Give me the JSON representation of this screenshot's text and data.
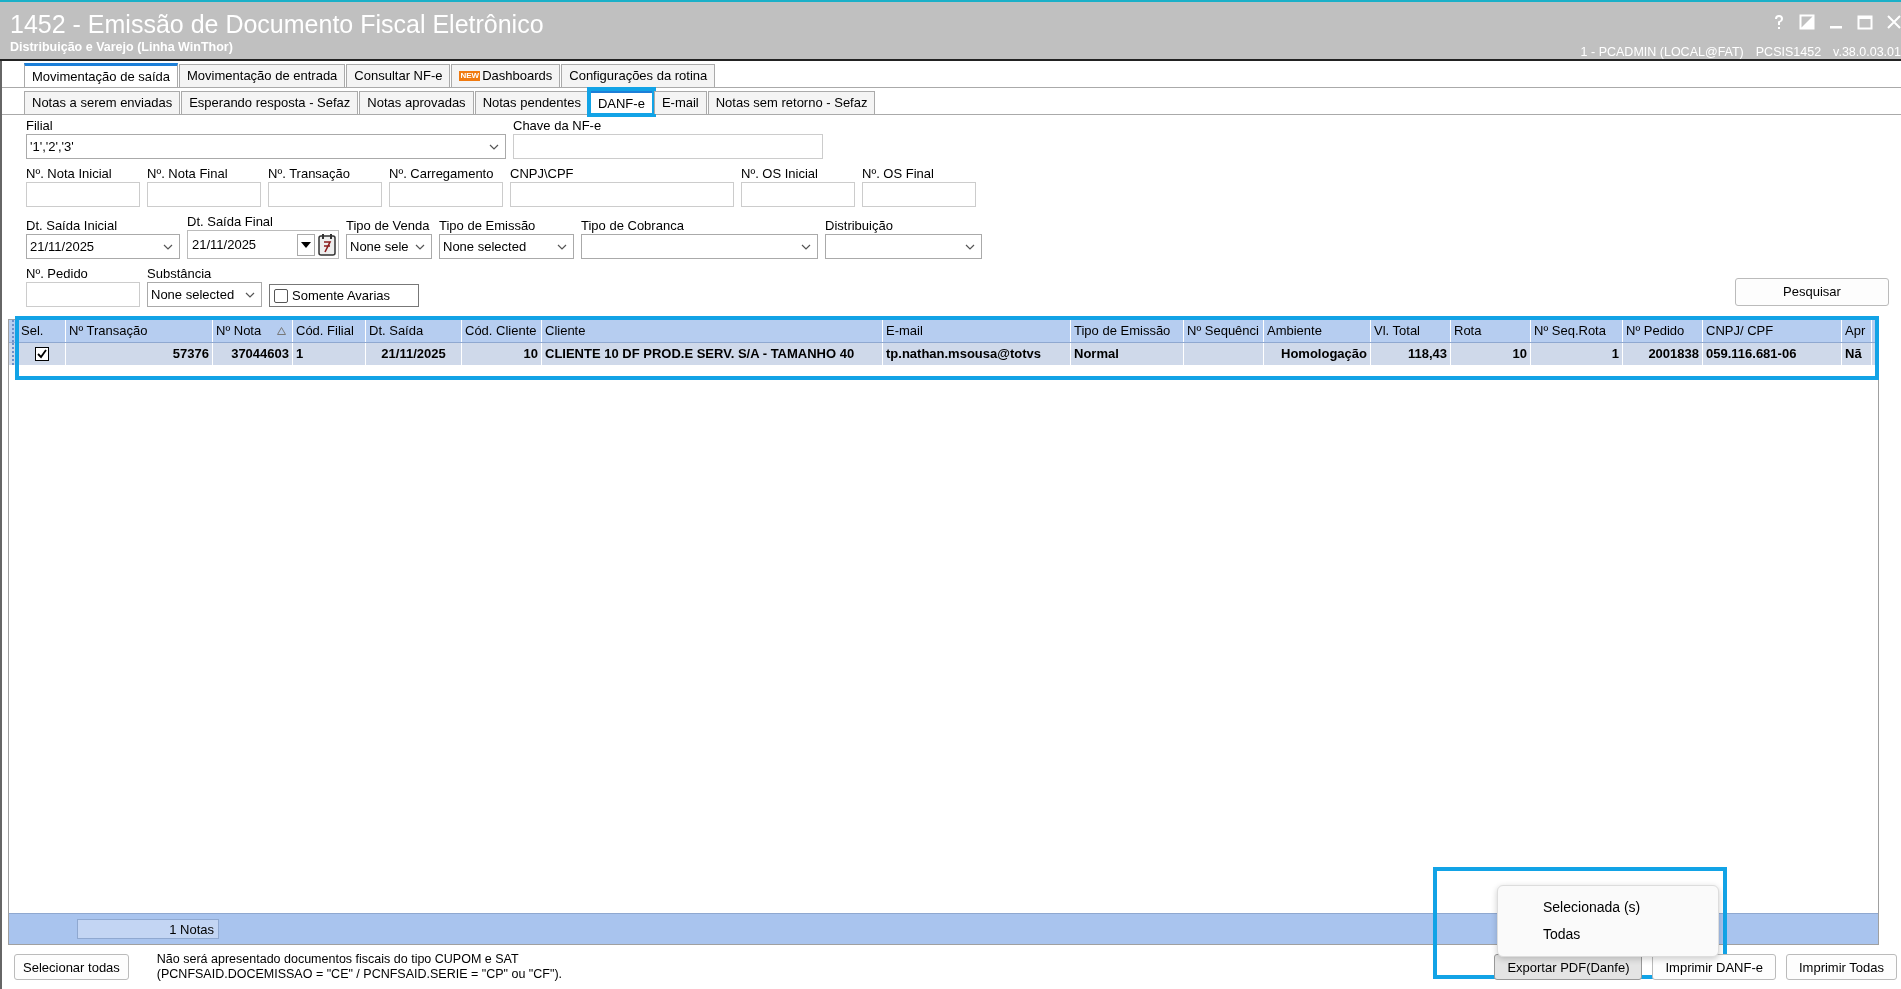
{
  "window": {
    "title": "1452 - Emissão de Documento Fiscal Eletrônico",
    "subtitle": "Distribuição e Varejo (Linha WinThor)",
    "status": [
      "1 - PCADMIN (LOCAL@FAT)",
      "PCSIS1452",
      "v.38.0.03.01"
    ]
  },
  "main_tabs": [
    {
      "label": "Movimentação de saída",
      "selected": true
    },
    {
      "label": "Movimentação de entrada",
      "selected": false
    },
    {
      "label": "Consultar NF-e",
      "selected": false
    },
    {
      "label": "Dashboards",
      "badge": "NEW",
      "selected": false
    },
    {
      "label": "Configurações da rotina",
      "selected": false
    }
  ],
  "sub_tabs": [
    {
      "label": "Notas a serem enviadas",
      "selected": false,
      "highlighted": false
    },
    {
      "label": "Esperando resposta - Sefaz",
      "selected": false,
      "highlighted": false
    },
    {
      "label": "Notas aprovadas",
      "selected": false,
      "highlighted": false
    },
    {
      "label": "Notas pendentes",
      "selected": false,
      "highlighted": false
    },
    {
      "label": "DANF-e",
      "selected": true,
      "highlighted": true
    },
    {
      "label": "E-mail",
      "selected": false,
      "highlighted": false
    },
    {
      "label": "Notas sem retorno - Sefaz",
      "selected": false,
      "highlighted": false
    }
  ],
  "filters": [
    [
      {
        "kind": "dropdown",
        "label": "Filial",
        "value": "'1','2','3'"
      },
      {
        "kind": "text",
        "label": "Chave da NF-e"
      }
    ],
    [
      {
        "kind": "text",
        "label": "Nº. Nota Inicial"
      },
      {
        "kind": "text",
        "label": "Nº. Nota Final"
      },
      {
        "kind": "text",
        "label": "Nº. Transação"
      },
      {
        "kind": "text",
        "label": "Nº. Carregamento"
      },
      {
        "kind": "text",
        "label": "CNPJ\\CPF"
      },
      {
        "kind": "text",
        "label": "Nº. OS Inicial"
      },
      {
        "kind": "text",
        "label": "Nº. OS Final"
      }
    ],
    [
      {
        "kind": "dropdown",
        "label": "Dt. Saída Inicial",
        "value": "21/11/2025"
      },
      {
        "kind": "date",
        "label": "Dt. Saída Final",
        "value": "21/11/2025"
      },
      {
        "kind": "dropdown",
        "label": "Tipo de Venda",
        "value": "None sele"
      },
      {
        "kind": "dropdown",
        "label": "Tipo de Emissão",
        "value": "None selected"
      },
      {
        "kind": "dropdown",
        "label": "Tipo de Cobranca"
      },
      {
        "kind": "dropdown",
        "label": "Distribuição"
      }
    ],
    [
      {
        "kind": "text",
        "label": "Nº. Pedido"
      },
      {
        "kind": "dropdown",
        "label": "Substância",
        "value": "None selected"
      },
      {
        "kind": "checkbox",
        "label": "Somente Avarias",
        "checked": false
      }
    ]
  ],
  "search_button": "Pesquisar",
  "table": {
    "highlighted": true,
    "columns": [
      {
        "label": "Sel.",
        "sorted": false
      },
      {
        "label": "Nº Transação",
        "sorted": false
      },
      {
        "label": "Nº Nota",
        "sorted": true
      },
      {
        "label": "Cód. Filial",
        "sorted": false
      },
      {
        "label": "Dt. Saída",
        "sorted": false
      },
      {
        "label": "Cód. Cliente",
        "sorted": false
      },
      {
        "label": "Cliente",
        "sorted": false
      },
      {
        "label": "E-mail",
        "sorted": false
      },
      {
        "label": "Tipo de Emissão",
        "sorted": false
      },
      {
        "label": "Nº Sequênci",
        "sorted": false
      },
      {
        "label": "Ambiente",
        "sorted": false
      },
      {
        "label": "Vl. Total",
        "sorted": false
      },
      {
        "label": "Rota",
        "sorted": false
      },
      {
        "label": "Nº Seq.Rota",
        "sorted": false
      },
      {
        "label": "Nº Pedido",
        "sorted": false
      },
      {
        "label": "CNPJ/ CPF",
        "sorted": false
      },
      {
        "label": "Apr",
        "sorted": false
      }
    ],
    "rows": [
      {
        "checked": true,
        "cells": [
          "",
          "57376",
          "37044603",
          "1",
          "21/11/2025",
          "10",
          "CLIENTE 10 DF PROD.E  SERV. S/A -  TAMANHO 40",
          "tp.nathan.msousa@totvs",
          "Normal",
          "",
          "Homologação",
          "118,43",
          "10",
          "1",
          "2001838",
          "059.116.681-06",
          "Nã"
        ]
      }
    ],
    "summary": "1 Notas"
  },
  "footer": {
    "select_all": "Selecionar todas",
    "note": "Não será apresentado documentos fiscais do tipo CUPOM e SAT\n(PCNFSAID.DOCEMISSAO = \"CE\" / PCNFSAID.SERIE = \"CP\" ou \"CF\").",
    "buttons": [
      {
        "label": "Exportar PDF(Danfe)",
        "pressed": true
      },
      {
        "label": "Imprimir DANF-e",
        "pressed": false
      },
      {
        "label": "Imprimir Todas",
        "pressed": false
      }
    ],
    "menu": {
      "highlighted": true,
      "items": [
        "Selecionada (s)",
        "Todas"
      ]
    }
  }
}
